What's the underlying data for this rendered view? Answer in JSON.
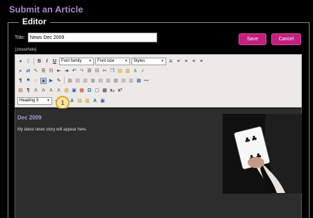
{
  "page": {
    "heading": "Submit an Article"
  },
  "editor": {
    "legend": "Editor",
    "title_label": "Title:",
    "title_value": "News Dec 2009",
    "save_label": "Save",
    "cancel_label": "Cancel",
    "show_hide_label": "[show/hide]"
  },
  "toolbar": {
    "font_family": "Font family",
    "font_size": "Font size",
    "styles": "Styles",
    "format": "Heading 3"
  },
  "callout": {
    "label": "1"
  },
  "content": {
    "heading": "Dec 2009",
    "body": "My latest news story will appear here."
  },
  "colors": {
    "accent": "#c2207e",
    "heading_purple": "#a888c8",
    "background": "#000000",
    "content_bg": "#2d2d2d"
  }
}
